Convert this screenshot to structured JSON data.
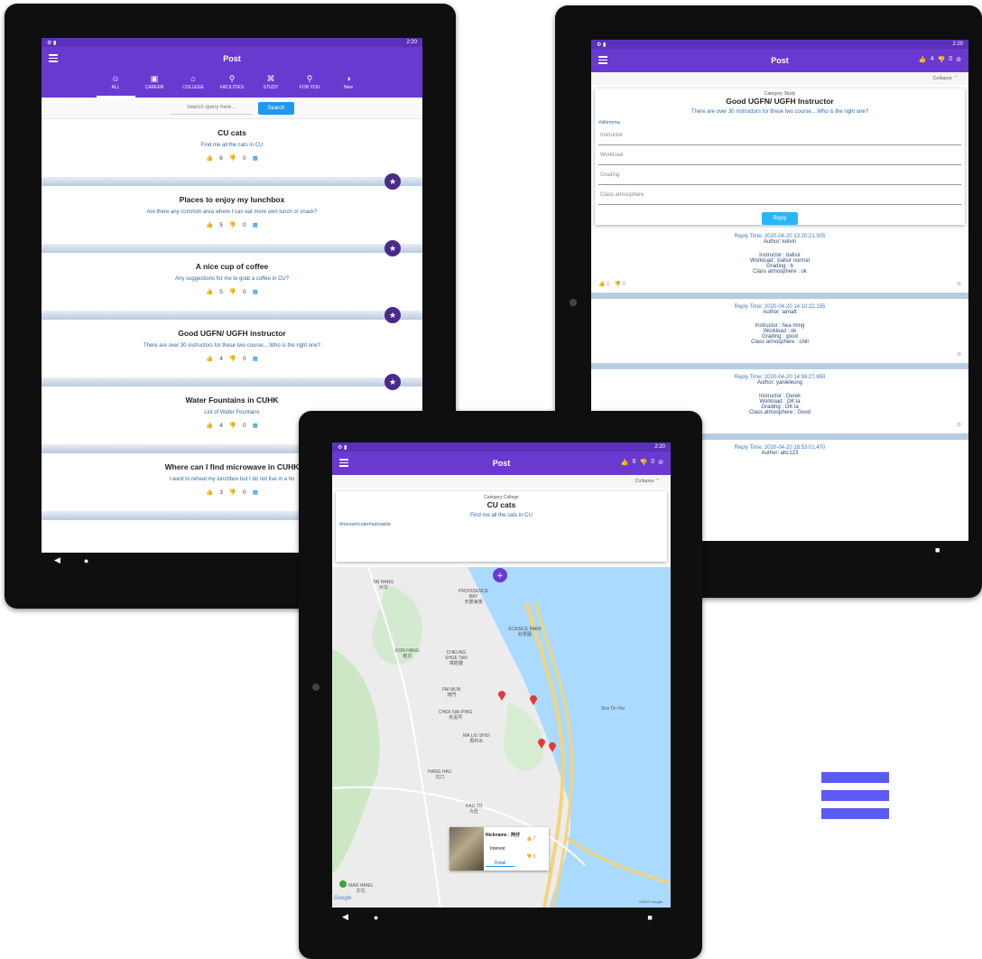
{
  "status": {
    "time": "2:20",
    "time_right": "2:20"
  },
  "list_screen": {
    "title": "Post",
    "tabs": [
      {
        "label": "ALL",
        "icon": "☺"
      },
      {
        "label": "CAREER",
        "icon": "▣"
      },
      {
        "label": "COLLEGE",
        "icon": "⌂"
      },
      {
        "label": "FACILITIES",
        "icon": "⚲"
      },
      {
        "label": "STUDY",
        "icon": "⌘"
      },
      {
        "label": "FOR YOU",
        "icon": "⚲"
      },
      {
        "label": "New",
        "icon": "◑"
      }
    ],
    "search": {
      "placeholder": "Search query here...",
      "button": "Search"
    },
    "posts": [
      {
        "title": "CU cats",
        "desc": "Find me all the cats in CU",
        "up": "6",
        "down": "0",
        "flag": "0"
      },
      {
        "title": "Places to enjoy my lunchbox",
        "desc": "Are there any common area where I can eat more own lunch or snack?",
        "up": "5",
        "down": "0",
        "flag": "0"
      },
      {
        "title": "A nice cup of coffee",
        "desc": "Any suggestions for me to grab a coffee in CU?",
        "up": "5",
        "down": "0",
        "flag": "0"
      },
      {
        "title": "Good UGFN/ UGFH instructor",
        "desc": "There are over 30 instructors for these two course....Who is the right one?",
        "up": "4",
        "down": "0",
        "flag": "0"
      },
      {
        "title": "Water Fountains in CUHK",
        "desc": "List of Water Fountains",
        "up": "4",
        "down": "0",
        "flag": "0"
      },
      {
        "title": "Where can I find microwave in CUHK",
        "desc": "I want to reheat my lunchbox but I do not live in a ho",
        "up": "3",
        "down": "0",
        "flag": "0"
      }
    ]
  },
  "detail_screen": {
    "title": "Post",
    "header_up": "4",
    "header_down": "0",
    "collapse": "Collapse",
    "category": "Category Study",
    "post_title": "Good UGFN/ UGFH Instructor",
    "post_desc": "There are over 30 instructors for these two course....Who is the right one?",
    "tags": "#dilemma",
    "fields": [
      "Instructor",
      "Workload",
      "Grading",
      "Class atmosphere"
    ],
    "reply_button": "Reply",
    "replies": [
      {
        "time": "Reply Time: 2020-04-20 13:20:21.505",
        "author": "Author: kelvin",
        "instructor": "Instructor : ballsir",
        "workload": "Workload : ballsir normal",
        "grading": "Grading : b",
        "atmosphere": "Class atmosphere : ok",
        "up": "1",
        "down": "0"
      },
      {
        "time": "Reply Time: 2020-04-20 14:10:22.155",
        "author": "Author: iamatt",
        "instructor": "Instructor : hea ming",
        "workload": "Workload : ok",
        "grading": "Grading : good",
        "atmosphere": "Class atmosphere : chill"
      },
      {
        "time": "Reply Time: 2020-04-20 14:59:27.650",
        "author": "Author: yanieleung",
        "instructor": "Instructor : Derek",
        "workload": "Workload : OK la",
        "grading": "Grading : OK la",
        "atmosphere": "Class atmosphere : Good"
      },
      {
        "time": "Reply Time: 2020-04-20 18:53:01.470",
        "author": "Author: abc123"
      }
    ]
  },
  "map_screen": {
    "title": "Post",
    "header_up": "6",
    "header_down": "0",
    "collapse": "Collapse",
    "category": "Category College",
    "post_title": "CU cats",
    "post_desc": "Find me all the cats in CU",
    "tags": "#meow#cutie#adorable",
    "places": {
      "tai_hang": "TAI HANG\n大坑",
      "providence": "PROVIDENCE\nBAY\n天覺海灣",
      "science_park": "SCIENCE PARK\n科學園",
      "kon_hang": "KON HANG\n乾坑",
      "cheung": "CHEUNG\nSHUE TAN\n樟樹灘",
      "pai_mun": "PAI MUN\n排門",
      "chek_nai_ping": "CHEK NAI PING\n赤泥坪",
      "ma_liu_shui": "MA LIU SHUI\n馬料水",
      "hang_hau": "HANG HAU\n坑口",
      "kau_to": "KAU TO\n九肚",
      "man_hang": "MAN HANG\n文坑",
      "sha_tin_hoi": "Sha Tin Hoi"
    },
    "popup": {
      "nickname": "Nickname : 阿仔",
      "interest": "Interest",
      "detail": "Detail",
      "up": "7",
      "down": "0"
    },
    "google": "Google",
    "copyright": "©2020 Google"
  },
  "colors": {
    "primary": "#6a3ad0",
    "accent": "#2196f3",
    "fab": "#4a2a8a",
    "logo": "#5a5af5"
  }
}
